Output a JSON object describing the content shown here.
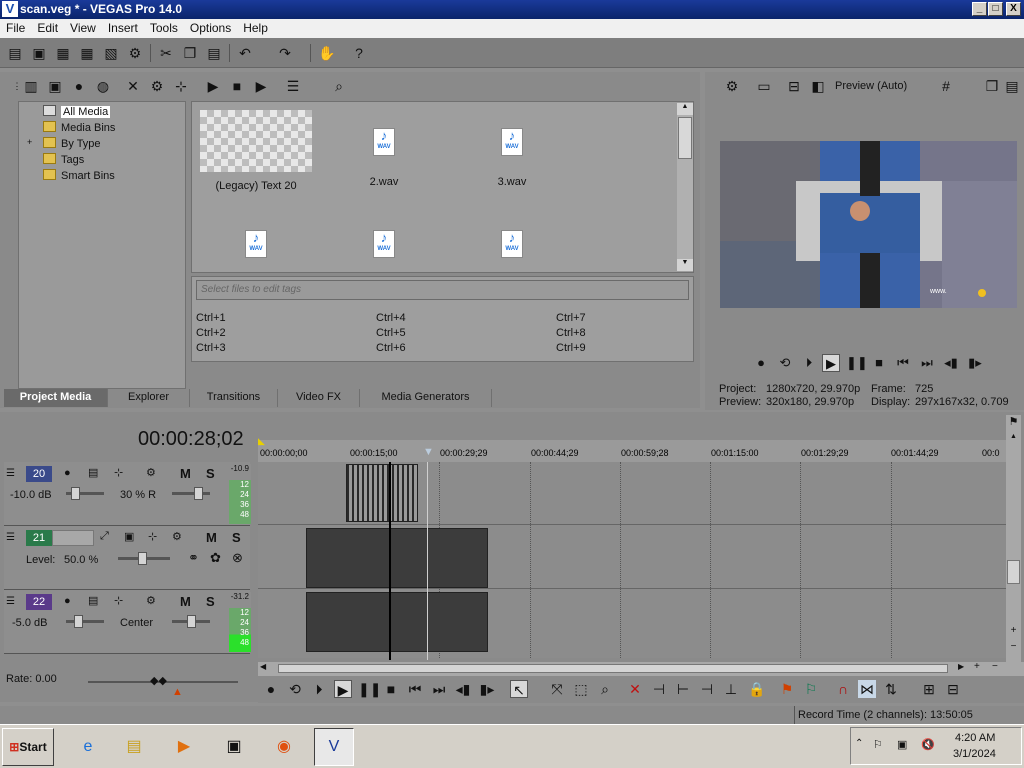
{
  "window": {
    "title": "scan.veg * - VEGAS Pro 14.0",
    "icon": "vegas-logo-icon",
    "controls": [
      "_",
      "□",
      "X"
    ]
  },
  "menu": [
    "File",
    "Edit",
    "View",
    "Insert",
    "Tools",
    "Options",
    "Help"
  ],
  "media_tree": [
    "All Media",
    "Media Bins",
    "By Type",
    "Tags",
    "Smart Bins"
  ],
  "media_items": [
    {
      "label": "(Legacy) Text 20",
      "icon": "checker-thumbnail"
    },
    {
      "label": "2.wav",
      "icon": "wav-file-icon"
    },
    {
      "label": "3.wav",
      "icon": "wav-file-icon"
    },
    {
      "label": "",
      "icon": "wav-file-icon"
    },
    {
      "label": "",
      "icon": "wav-file-icon"
    },
    {
      "label": "",
      "icon": "wav-file-icon"
    }
  ],
  "tags": {
    "placeholder": "Select files to edit tags",
    "shortcuts": [
      "Ctrl+1",
      "Ctrl+2",
      "Ctrl+3",
      "Ctrl+4",
      "Ctrl+5",
      "Ctrl+6",
      "Ctrl+7",
      "Ctrl+8",
      "Ctrl+9"
    ]
  },
  "tabs": [
    "Project Media",
    "Explorer",
    "Transitions",
    "Video FX",
    "Media Generators"
  ],
  "active_tab": "Project Media",
  "preview": {
    "mode": "Preview (Auto)",
    "project_label": "Project:",
    "project_value": "1280x720, 29.970p",
    "frame_label": "Frame:",
    "frame_value": "725",
    "preview_label": "Preview:",
    "preview_value": "320x180, 29.970p",
    "display_label": "Display:",
    "display_value": "297x167x32, 0.709"
  },
  "timeline": {
    "timecode": "00:00:28;02",
    "ruler": [
      "00:00:00;00",
      "00:00:15;00",
      "00:00:29;29",
      "00:00:44;29",
      "00:00:59;28",
      "00:01:15:00",
      "00:01:29;29",
      "00:01:44;29",
      "00:0"
    ],
    "tracks": [
      {
        "number": "20",
        "type": "audio",
        "color": "#3a4a8a",
        "volume": "-10.0 dB",
        "pan": "30 % R",
        "peak": "-10.9",
        "meter_marks": [
          "12",
          "24",
          "36",
          "48"
        ]
      },
      {
        "number": "21",
        "type": "video",
        "color": "#2a7a4a",
        "level_label": "Level:",
        "level": "50.0 %"
      },
      {
        "number": "22",
        "type": "audio",
        "color": "#5a3a8a",
        "volume": "-5.0 dB",
        "pan": "Center",
        "peak": "-31.2",
        "meter_marks": [
          "12",
          "24",
          "36",
          "48"
        ]
      }
    ],
    "mute": "M",
    "solo": "S",
    "rate": "Rate: 0.00"
  },
  "status": {
    "record_time": "Record Time (2 channels): 13:50:05"
  },
  "taskbar": {
    "start": "Start",
    "apps": [
      "ie-icon",
      "explorer-icon",
      "media-player-icon",
      "computer-icon",
      "firefox-icon",
      "vegas-icon"
    ],
    "time": "4:20 AM",
    "date": "3/1/2024"
  },
  "colors": {
    "titlebar": "#0a246a",
    "panel": "#8a8a8a",
    "active_tab": "#6a6a6a"
  }
}
